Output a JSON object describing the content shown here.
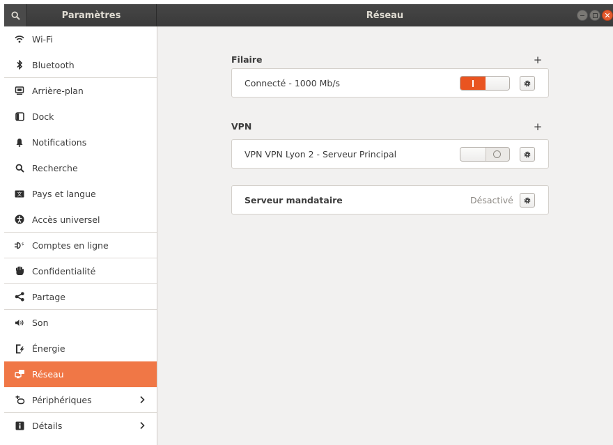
{
  "header": {
    "sidebar_title": "Paramètres",
    "main_title": "Réseau"
  },
  "sidebar": {
    "items": [
      {
        "label": "Wi-Fi",
        "icon": "wifi-icon"
      },
      {
        "label": "Bluetooth",
        "icon": "bluetooth-icon"
      },
      {
        "label": "Arrière-plan",
        "icon": "background-icon"
      },
      {
        "label": "Dock",
        "icon": "dock-icon"
      },
      {
        "label": "Notifications",
        "icon": "bell-icon"
      },
      {
        "label": "Recherche",
        "icon": "search-icon"
      },
      {
        "label": "Pays et langue",
        "icon": "language-icon"
      },
      {
        "label": "Accès universel",
        "icon": "accessibility-icon"
      },
      {
        "label": "Comptes en ligne",
        "icon": "online-accounts-icon"
      },
      {
        "label": "Confidentialité",
        "icon": "privacy-hand-icon"
      },
      {
        "label": "Partage",
        "icon": "share-icon"
      },
      {
        "label": "Son",
        "icon": "speaker-icon"
      },
      {
        "label": "Énergie",
        "icon": "power-icon"
      },
      {
        "label": "Réseau",
        "icon": "network-icon",
        "active": true
      },
      {
        "label": "Périphériques",
        "icon": "devices-icon",
        "chevron": true
      },
      {
        "label": "Détails",
        "icon": "info-icon",
        "chevron": true
      }
    ]
  },
  "wired": {
    "title": "Filaire",
    "add_label": "+",
    "connection_label": "Connecté - 1000 Mb/s",
    "switch_on": true
  },
  "vpn": {
    "title": "VPN",
    "add_label": "+",
    "connection_label": "VPN VPN Lyon 2 - Serveur Principal",
    "switch_on": false
  },
  "proxy": {
    "label": "Serveur mandataire",
    "status": "Désactivé"
  },
  "colors": {
    "accent": "#e95420",
    "sidebar_active": "#f07746",
    "headerbar": "#3d3d3d",
    "background": "#f2f1f0"
  }
}
